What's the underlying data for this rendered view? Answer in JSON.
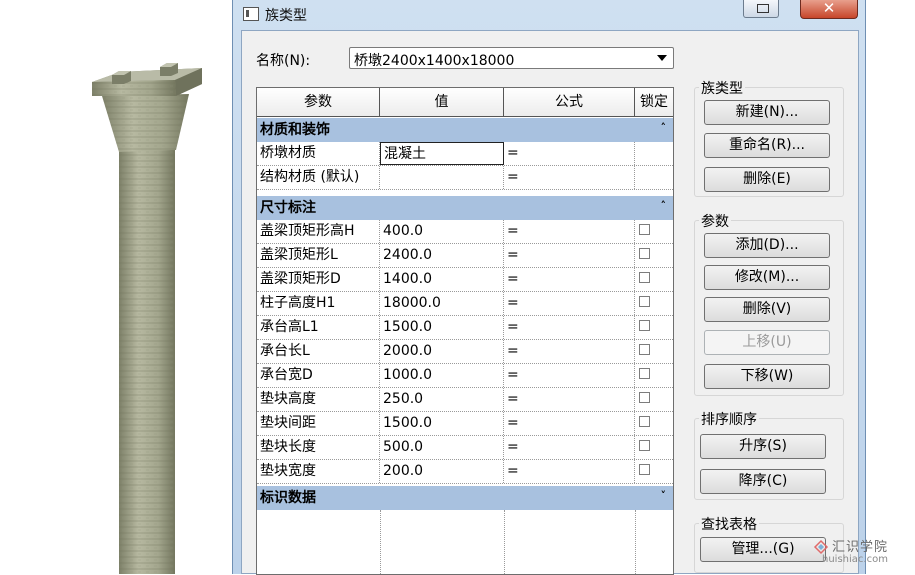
{
  "dialog": {
    "title": "族类型",
    "close_glyph": "✕",
    "name_label": "名称(N):",
    "name_value": "桥墩2400x1400x18000"
  },
  "grid": {
    "headers": [
      "参数",
      "值",
      "公式",
      "锁定"
    ],
    "groups": [
      {
        "title": "材质和装饰",
        "chevron": "˄",
        "rows": [
          {
            "param": "桥墩材质",
            "value": "混凝土",
            "formula": "=",
            "lock": false
          },
          {
            "param": "结构材质 (默认)",
            "value": "",
            "formula": "=",
            "lock": false
          }
        ]
      },
      {
        "title": "尺寸标注",
        "chevron": "˄",
        "rows": [
          {
            "param": "盖梁顶矩形高H",
            "value": "400.0",
            "formula": "=",
            "lock": true
          },
          {
            "param": "盖梁顶矩形L",
            "value": "2400.0",
            "formula": "=",
            "lock": true
          },
          {
            "param": "盖梁顶矩形D",
            "value": "1400.0",
            "formula": "=",
            "lock": true
          },
          {
            "param": "柱子高度H1",
            "value": "18000.0",
            "formula": "=",
            "lock": true
          },
          {
            "param": "承台高L1",
            "value": "1500.0",
            "formula": "=",
            "lock": true
          },
          {
            "param": "承台长L",
            "value": "2000.0",
            "formula": "=",
            "lock": true
          },
          {
            "param": "承台宽D",
            "value": "1000.0",
            "formula": "=",
            "lock": true
          },
          {
            "param": "垫块高度",
            "value": "250.0",
            "formula": "=",
            "lock": true
          },
          {
            "param": "垫块间距",
            "value": "1500.0",
            "formula": "=",
            "lock": true
          },
          {
            "param": "垫块长度",
            "value": "500.0",
            "formula": "=",
            "lock": true
          },
          {
            "param": "垫块宽度",
            "value": "200.0",
            "formula": "=",
            "lock": true
          }
        ]
      },
      {
        "title": "标识数据",
        "chevron": "˅",
        "rows": []
      }
    ]
  },
  "panel": {
    "family_types": {
      "legend": "族类型",
      "new_label": "新建(N)...",
      "rename_label": "重命名(R)...",
      "delete_label": "删除(E)"
    },
    "parameters": {
      "legend": "参数",
      "add_label": "添加(D)...",
      "modify_label": "修改(M)...",
      "remove_label": "删除(V)",
      "move_up_label": "上移(U)",
      "move_down_label": "下移(W)"
    },
    "sort": {
      "legend": "排序顺序",
      "ascending_label": "升序(S)",
      "descending_label": "降序(C)"
    },
    "lookup": {
      "legend": "查找表格",
      "manage_label": "管理...(G)"
    }
  },
  "watermark": {
    "text": "汇识学院",
    "url": "huishiac.com"
  },
  "colors": {
    "group_header": "#a8c1df",
    "title_bar": "#c4d7ec",
    "close_button": "#c7462a",
    "pier_concrete": "#a6a990"
  }
}
